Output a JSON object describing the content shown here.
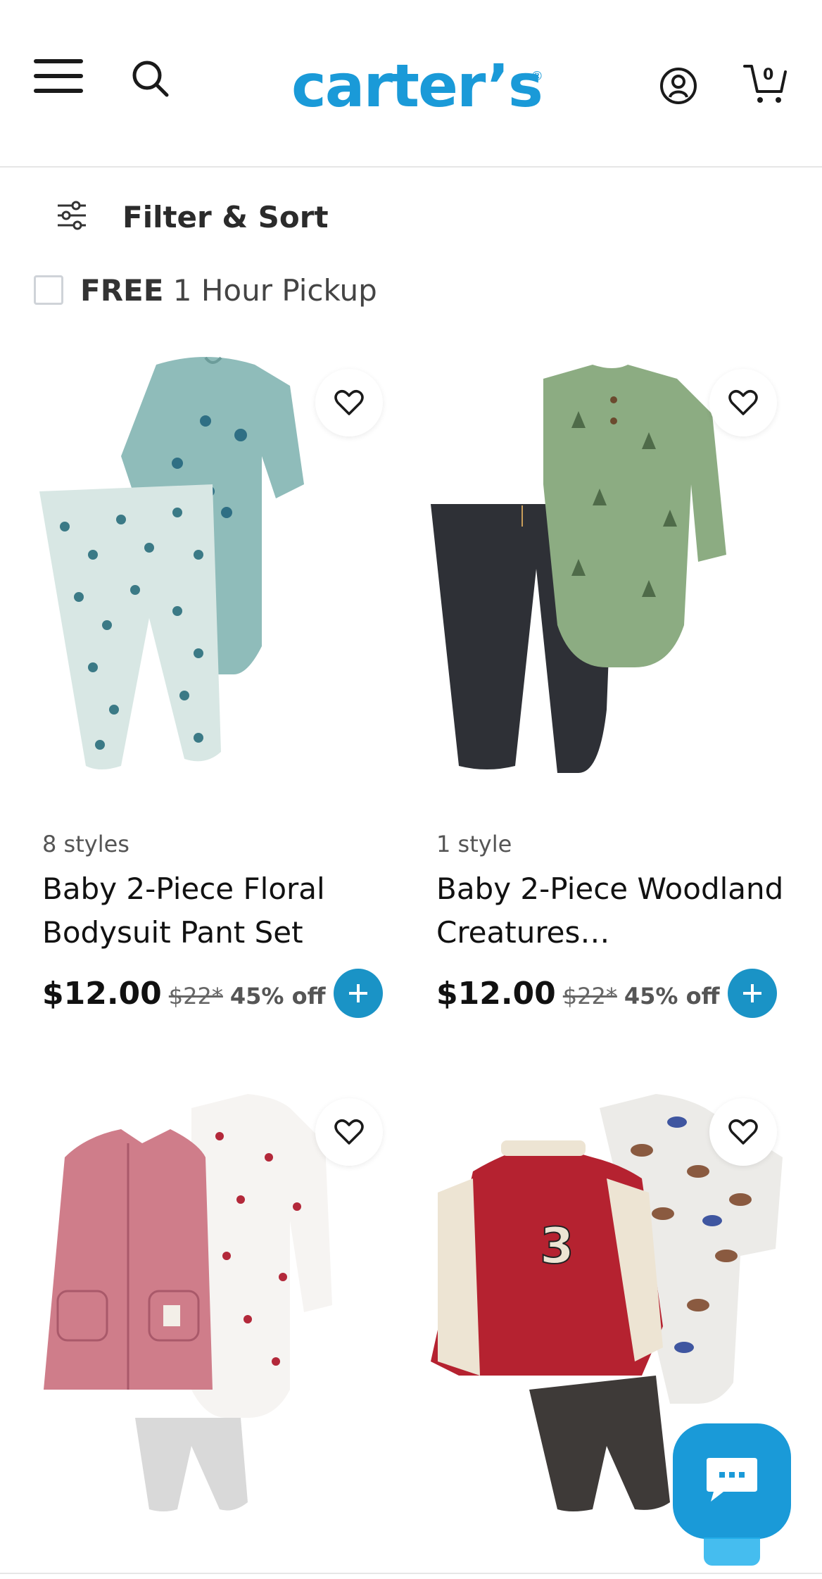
{
  "header": {
    "logo": "carter’s",
    "logo_mark": "®",
    "cart_count": "0",
    "icons": {
      "menu": "hamburger-menu-icon",
      "search": "search-icon",
      "account": "account-icon",
      "cart": "cart-icon"
    }
  },
  "filter": {
    "label": "Filter & Sort",
    "icon": "sliders-icon"
  },
  "pickup": {
    "bold": "FREE",
    "text": " 1 Hour Pickup",
    "checked": false
  },
  "colors": {
    "brand": "#1a9ad8",
    "add_button": "#1a93c6",
    "text": "#111111"
  },
  "products": [
    {
      "styles": "8 styles",
      "name": "Baby 2-Piece Floral Bodysuit Pant Set",
      "price": "$12.00",
      "original_price": "$22*",
      "discount": "45% off"
    },
    {
      "styles": "1 style",
      "name": "Baby 2-Piece Woodland Creatures…",
      "price": "$12.00",
      "original_price": "$22*",
      "discount": "45% off"
    },
    {
      "styles": "",
      "name": "",
      "price": "",
      "original_price": "",
      "discount": ""
    },
    {
      "styles": "",
      "name": "",
      "price": "",
      "original_price": "",
      "discount": ""
    }
  ],
  "chat": {
    "icon": "chat-bubble-icon"
  }
}
